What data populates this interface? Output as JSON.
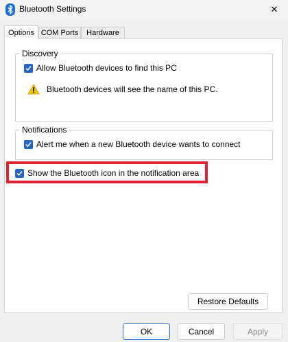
{
  "window": {
    "title": "Bluetooth Settings",
    "close_glyph": "✕"
  },
  "tabs": [
    {
      "label": "Options",
      "active": true
    },
    {
      "label": "COM Ports",
      "active": false
    },
    {
      "label": "Hardware",
      "active": false
    }
  ],
  "discovery": {
    "label": "Discovery",
    "allow_find": {
      "label": "Allow Bluetooth devices to find this PC",
      "checked": true
    },
    "warning_text": "Bluetooth devices will see the name of this PC.",
    "warning_icon": "warning-icon"
  },
  "notifications": {
    "label": "Notifications",
    "alert_new": {
      "label": "Alert me when a new Bluetooth device wants to connect",
      "checked": true
    }
  },
  "show_icon": {
    "label": "Show the Bluetooth icon in the notification area",
    "checked": true
  },
  "buttons": {
    "restore_defaults": "Restore Defaults",
    "ok": "OK",
    "cancel": "Cancel",
    "apply": "Apply"
  },
  "colors": {
    "accent": "#2563c4",
    "highlight": "#e0202e",
    "warning": "#f2c200"
  }
}
